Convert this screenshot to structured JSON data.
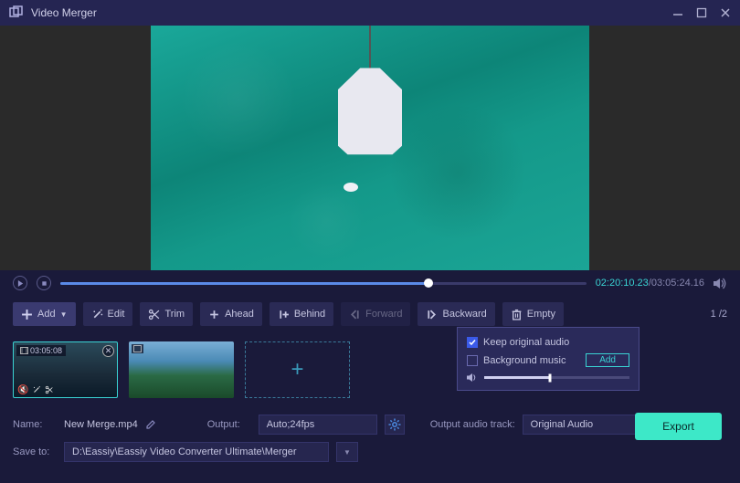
{
  "app": {
    "title": "Video Merger"
  },
  "playback": {
    "current_time": "02:20:10.23",
    "total_time": "03:05:24.16",
    "progress_pct": 70
  },
  "toolbar": {
    "add": "Add",
    "edit": "Edit",
    "trim": "Trim",
    "ahead": "Ahead",
    "behind": "Behind",
    "forward": "Forward",
    "backward": "Backward",
    "empty": "Empty",
    "page_current": "1",
    "page_sep": "/",
    "page_total": "2"
  },
  "clips": [
    {
      "duration": "03:05:08",
      "selected": true
    },
    {
      "duration": "",
      "selected": false
    }
  ],
  "audio_panel": {
    "keep_original": "Keep original audio",
    "bg_music": "Background music",
    "add_btn": "Add",
    "volume_pct": 45
  },
  "bottom": {
    "name_label": "Name:",
    "name_value": "New Merge.mp4",
    "output_label": "Output:",
    "output_value": "Auto;24fps",
    "audio_track_label": "Output audio track:",
    "audio_track_value": "Original Audio",
    "save_label": "Save to:",
    "save_path": "D:\\Eassiy\\Eassiy Video Converter Ultimate\\Merger",
    "export": "Export"
  }
}
